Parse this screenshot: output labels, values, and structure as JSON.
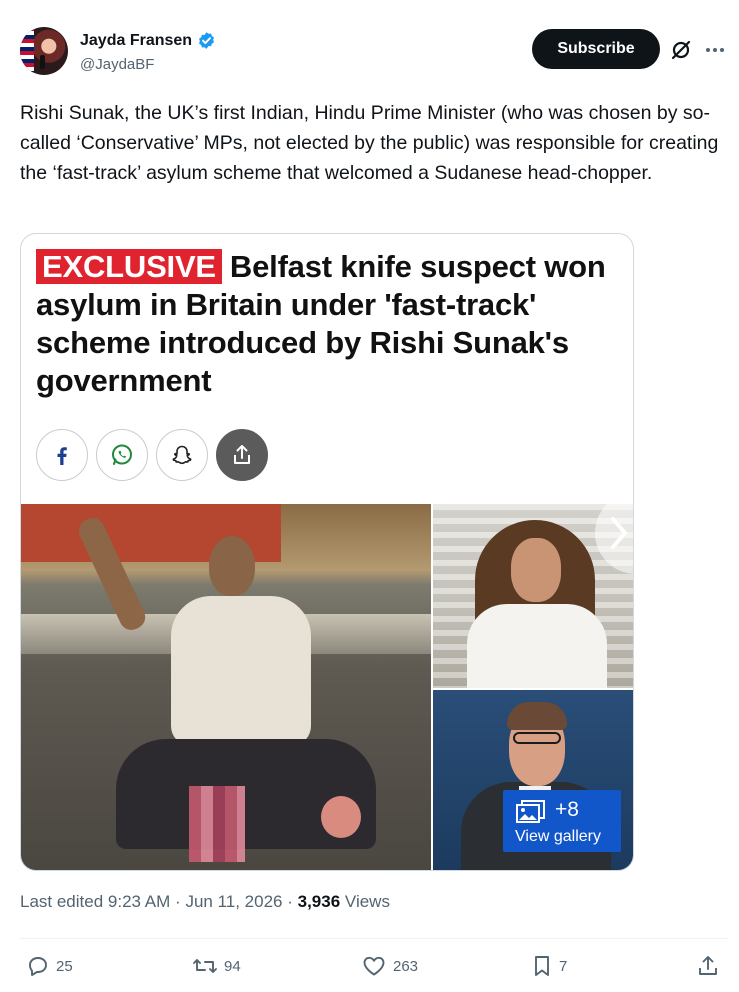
{
  "author": {
    "display_name": "Jayda Fransen",
    "handle": "@JaydaBF",
    "verified": true
  },
  "header_actions": {
    "subscribe_label": "Subscribe",
    "grok_icon": "grok-slash-circle-icon",
    "more_icon": "more-horizontal-icon"
  },
  "tweet": {
    "text": "Rishi Sunak, the UK’s first Indian, Hindu Prime Minister (who was chosen by so-called ‘Conservative’ MPs, not elected by the public) was responsible for creating the ‘fast-track’ asylum scheme that welcomed a Sudanese head-chopper."
  },
  "card": {
    "exclusive_label": "EXCLUSIVE",
    "headline": "Belfast knife suspect won asylum in Britain under 'fast-track' scheme introduced by Rishi Sunak's government",
    "share_buttons": [
      "facebook-icon",
      "whatsapp-icon",
      "snapchat-icon",
      "share-icon"
    ],
    "gallery": {
      "count": "+8",
      "label": "View gallery"
    },
    "accent_color": "#e0242f",
    "gallery_color": "#1257c9"
  },
  "meta": {
    "edited_label": "Last edited",
    "time": "9:23 AM",
    "separator": "·",
    "date": "Jun 11, 2026",
    "views_count": "3,936",
    "views_label": "Views"
  },
  "actions": {
    "replies": "25",
    "reposts": "94",
    "likes": "263",
    "bookmarks": "7"
  }
}
